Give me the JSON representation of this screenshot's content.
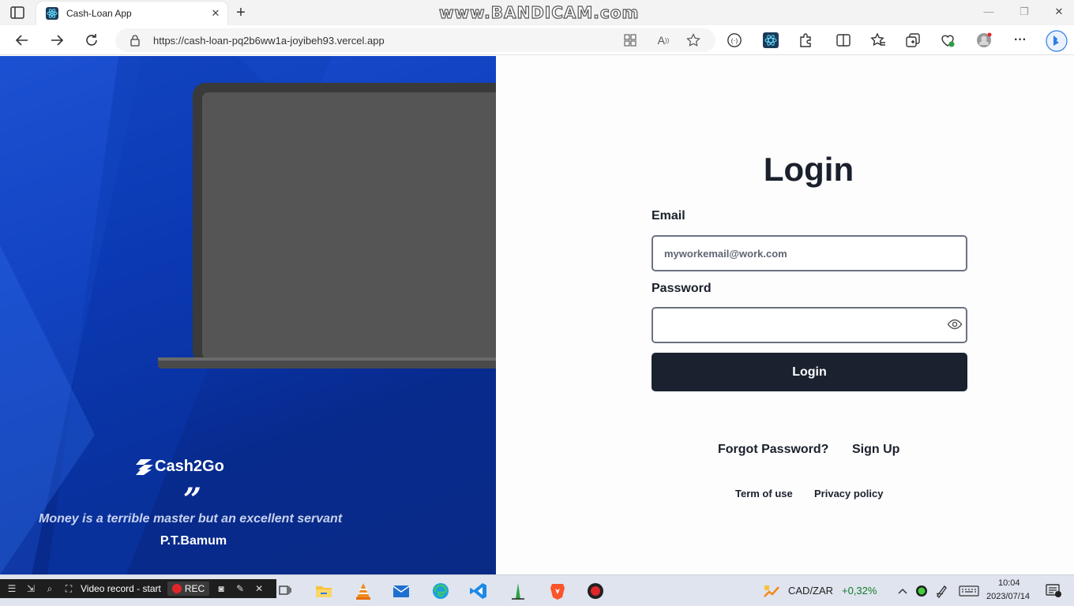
{
  "browser": {
    "tab_title": "Cash-Loan App",
    "url": "https://cash-loan-pq2b6ww1a-joyibeh93.vercel.app",
    "watermark": "www.BANDICAM.com"
  },
  "hero": {
    "brand_name": "Cash2Go",
    "quote_mark": "”",
    "quote": "Money is a terrible master but an excellent servant",
    "author": "P.T.Bamum",
    "colors": {
      "background": "#0c3ab8",
      "laptop_screen": "#555555"
    }
  },
  "login": {
    "title": "Login",
    "email_label": "Email",
    "email_placeholder": "myworkemail@work.com",
    "password_label": "Password",
    "submit_label": "Login",
    "forgot_password": "Forgot Password?",
    "sign_up": "Sign Up",
    "terms": "Term of use",
    "privacy": "Privacy policy",
    "colors": {
      "button": "#1a2230",
      "text": "#1a202c"
    }
  },
  "taskbar": {
    "bandicam_label": "Video record - start",
    "rec_label": "REC",
    "fx_pair": "CAD/ZAR",
    "fx_change": "+0,32%",
    "time": "10:04",
    "date": "2023/07/14"
  }
}
